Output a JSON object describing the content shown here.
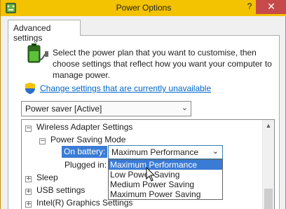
{
  "window": {
    "title": "Power Options",
    "help_label": "?",
    "close_label": "✕"
  },
  "tab": {
    "label": "Advanced settings"
  },
  "intro": {
    "text": "Select the power plan that you want to customise, then choose settings that reflect how you want your computer to manage power."
  },
  "change_link": {
    "label": "Change settings that are currently unavailable"
  },
  "plan_select": {
    "value": "Power saver [Active]"
  },
  "tree": {
    "wireless": {
      "expander": "−",
      "label": "Wireless Adapter Settings"
    },
    "power_saving_mode": {
      "expander": "−",
      "label": "Power Saving Mode"
    },
    "on_battery_label": "On battery:",
    "plugged_in_label": "Plugged in:",
    "sleep": {
      "expander": "+",
      "label": "Sleep"
    },
    "usb": {
      "expander": "+",
      "label": "USB settings"
    },
    "graphics": {
      "expander": "+",
      "label": "Intel(R) Graphics Settings"
    }
  },
  "on_battery_select": {
    "value": "Maximum Performance"
  },
  "dropdown_options": [
    "Maximum Performance",
    "Low Power Saving",
    "Medium Power Saving",
    "Maximum Power Saving"
  ],
  "colors": {
    "titlebar": "#f3c200",
    "close": "#c74a4a",
    "selection": "#3a7bd5",
    "link": "#0066cc"
  },
  "icons": {
    "app": "power-options-icon",
    "battery": "battery-plug-icon",
    "shield": "uac-shield-icon"
  }
}
